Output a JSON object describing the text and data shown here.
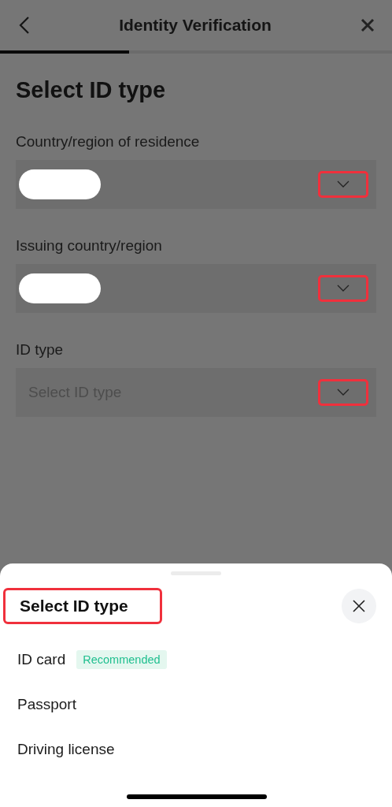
{
  "header": {
    "title": "Identity Verification",
    "progress": {
      "level": 0.33
    }
  },
  "page_title": "Select ID type",
  "fields": [
    {
      "label": "Country/region of residence",
      "kind": "redacted",
      "chevron_highlighted": true
    },
    {
      "label": "Issuing country/region",
      "kind": "redacted",
      "chevron_highlighted": true
    },
    {
      "label": "ID type",
      "kind": "placeholder",
      "placeholder": "Select ID type",
      "chevron_highlighted": true
    }
  ],
  "sheet": {
    "title": "Select ID type",
    "title_highlighted": true,
    "options": [
      {
        "label": "ID card",
        "badge": "Recommended"
      },
      {
        "label": "Passport"
      },
      {
        "label": "Driving license"
      }
    ]
  }
}
